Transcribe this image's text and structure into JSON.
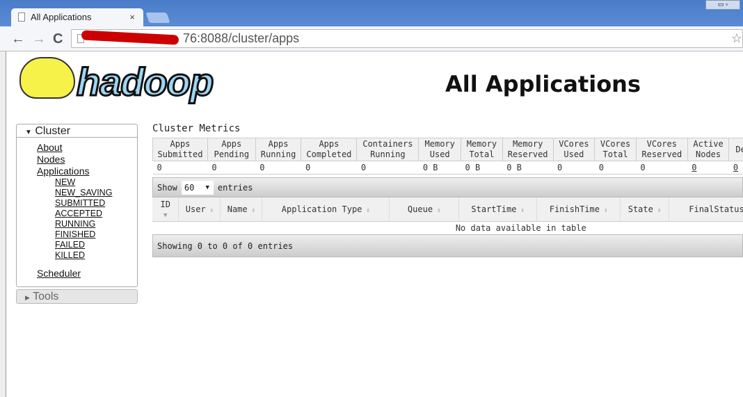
{
  "browser": {
    "tab_title": "All Applications",
    "tab_close": "×",
    "url": "76:8088/cluster/apps",
    "back": "←",
    "forward": "→",
    "reload": "C",
    "star": "☆",
    "window_buttons": "▭ ▫"
  },
  "logo": {
    "text": "hadoop"
  },
  "page_title": "All Applications",
  "sidebar": {
    "cluster_label": "Cluster",
    "tools_label": "Tools",
    "items": [
      "About",
      "Nodes",
      "Applications"
    ],
    "app_states": [
      "NEW",
      "NEW_SAVING",
      "SUBMITTED",
      "ACCEPTED",
      "RUNNING",
      "FINISHED",
      "FAILED",
      "KILLED"
    ],
    "scheduler": "Scheduler"
  },
  "metrics": {
    "title": "Cluster Metrics",
    "headers": [
      [
        "Apps",
        "Submitted"
      ],
      [
        "Apps",
        "Pending"
      ],
      [
        "Apps",
        "Running"
      ],
      [
        "Apps",
        "Completed"
      ],
      [
        "Containers",
        "Running"
      ],
      [
        "Memory",
        "Used"
      ],
      [
        "Memory",
        "Total"
      ],
      [
        "Memory",
        "Reserved"
      ],
      [
        "VCores",
        "Used"
      ],
      [
        "VCores",
        "Total"
      ],
      [
        "VCores",
        "Reserved"
      ],
      [
        "Active",
        "Nodes"
      ],
      [
        "Dec",
        ""
      ]
    ],
    "values": [
      "0",
      "0",
      "0",
      "0",
      "0",
      "0 B",
      "0 B",
      "0 B",
      "0",
      "0",
      "0",
      "0",
      "0"
    ]
  },
  "apps": {
    "show_label": "Show",
    "entries_label": "entries",
    "page_size": "60",
    "columns": [
      "ID",
      "User",
      "Name",
      "Application Type",
      "Queue",
      "StartTime",
      "FinishTime",
      "State",
      "FinalStatus"
    ],
    "empty": "No data available in table",
    "info": "Showing 0 to 0 of 0 entries"
  }
}
